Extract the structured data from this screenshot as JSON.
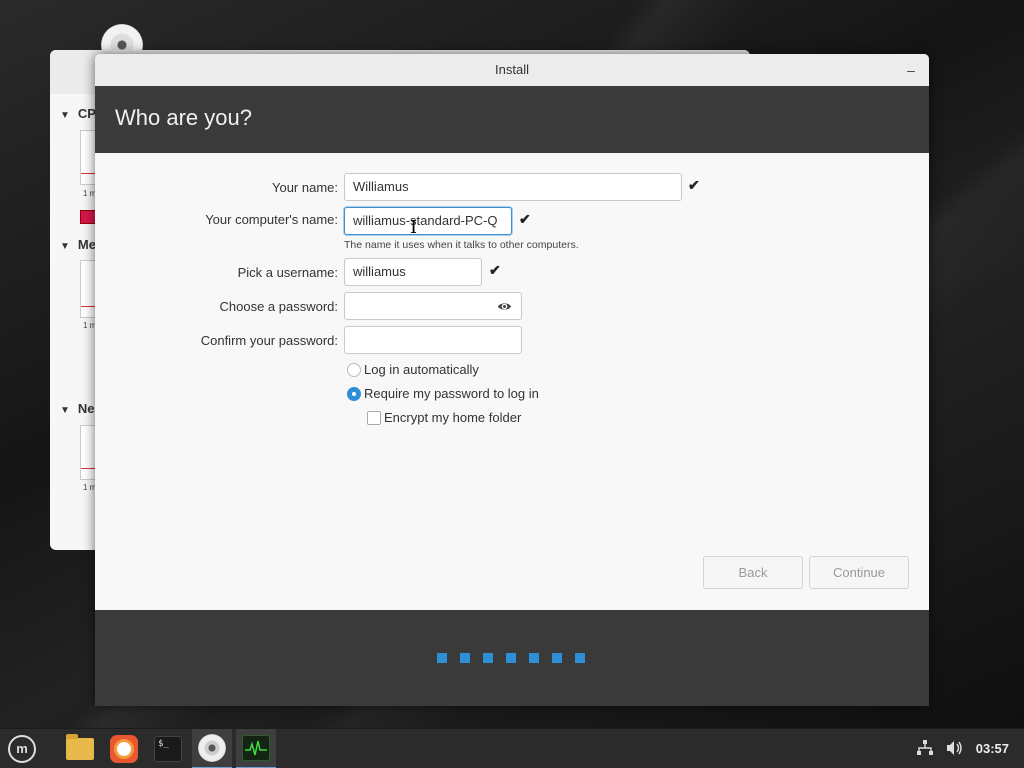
{
  "window": {
    "title": "Install",
    "minimize_label": "–"
  },
  "page": {
    "heading": "Who are you?"
  },
  "form": {
    "name_label": "Your name:",
    "name_value": "Williamus",
    "computer_label": "Your computer's name:",
    "computer_value": "williamus-standard-PC-Q",
    "computer_hint": "The name it uses when it talks to other computers.",
    "username_label": "Pick a username:",
    "username_value": "williamus",
    "password_label": "Choose a password:",
    "password_value": "",
    "confirm_label": "Confirm your password:",
    "confirm_value": "",
    "check_glyph": "✔"
  },
  "options": {
    "auto_login": "Log in automatically",
    "require_password": "Require my password to log in",
    "encrypt_home": "Encrypt my home folder",
    "selected": "require_password",
    "encrypt_checked": false
  },
  "buttons": {
    "back": "Back",
    "continue": "Continue"
  },
  "progress": {
    "total_steps": 7
  },
  "background_window": {
    "sections": [
      "CP",
      "Me",
      "Ne"
    ],
    "tick_label": "1 m"
  },
  "taskbar": {
    "apps": [
      "menu-icon",
      "files-icon",
      "firefox-icon",
      "terminal-icon",
      "installer-disc-icon",
      "system-monitor-icon"
    ],
    "terminal_glyph": "$_",
    "menu_glyph": "m",
    "clock": "03:57"
  },
  "colors": {
    "accent": "#2f8fd4",
    "header_bg": "#3a3a3a"
  }
}
